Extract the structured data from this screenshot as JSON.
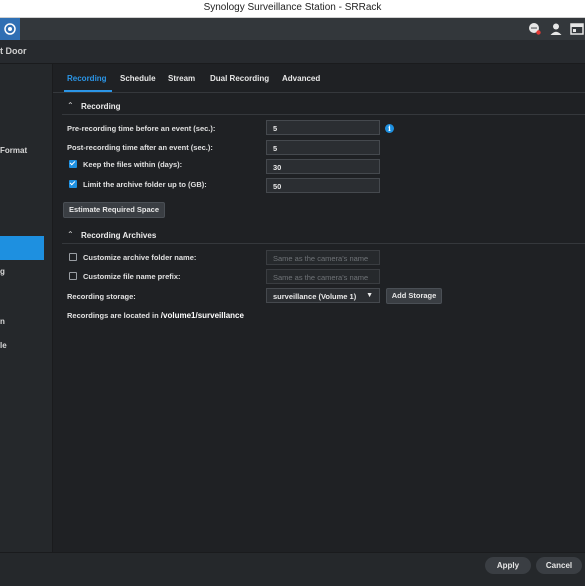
{
  "window": {
    "title": "Synology Surveillance Station - SRRack"
  },
  "toolbar": {
    "icons": [
      "app-icon",
      "chat-icon",
      "user-icon",
      "window-icon"
    ]
  },
  "camera": {
    "title_visible": "t Door"
  },
  "sidebar": {
    "items": [
      {
        "label": "Format"
      },
      {
        "label": "",
        "active": true
      },
      {
        "label": "g"
      },
      {
        "label": "n"
      },
      {
        "label": "le"
      }
    ]
  },
  "tabs": [
    {
      "label": "Recording",
      "active": true
    },
    {
      "label": "Schedule"
    },
    {
      "label": "Stream"
    },
    {
      "label": "Dual Recording"
    },
    {
      "label": "Advanced"
    }
  ],
  "recording": {
    "section_title": "Recording",
    "pre_label": "Pre-recording time before an event (sec.):",
    "pre_value": "5",
    "post_label": "Post-recording time after an event (sec.):",
    "post_value": "5",
    "keep_label": "Keep the files within (days):",
    "keep_value": "30",
    "keep_checked": true,
    "limit_label": "Limit the archive folder up to (GB):",
    "limit_value": "50",
    "limit_checked": true,
    "estimate_button": "Estimate Required Space"
  },
  "archives": {
    "section_title": "Recording Archives",
    "folder_label": "Customize archive folder name:",
    "folder_placeholder": "Same as the camera's name",
    "folder_checked": false,
    "prefix_label": "Customize file name prefix:",
    "prefix_placeholder": "Same as the camera's name",
    "prefix_checked": false,
    "storage_label": "Recording storage:",
    "storage_value": "surveillance (Volume 1)",
    "add_storage_button": "Add Storage",
    "location_text": "Recordings are located in",
    "location_path": "/volume1/surveillance"
  },
  "footer": {
    "apply": "Apply",
    "cancel": "Cancel"
  },
  "colors": {
    "accent": "#1e90e0",
    "background": "#1f2124"
  }
}
